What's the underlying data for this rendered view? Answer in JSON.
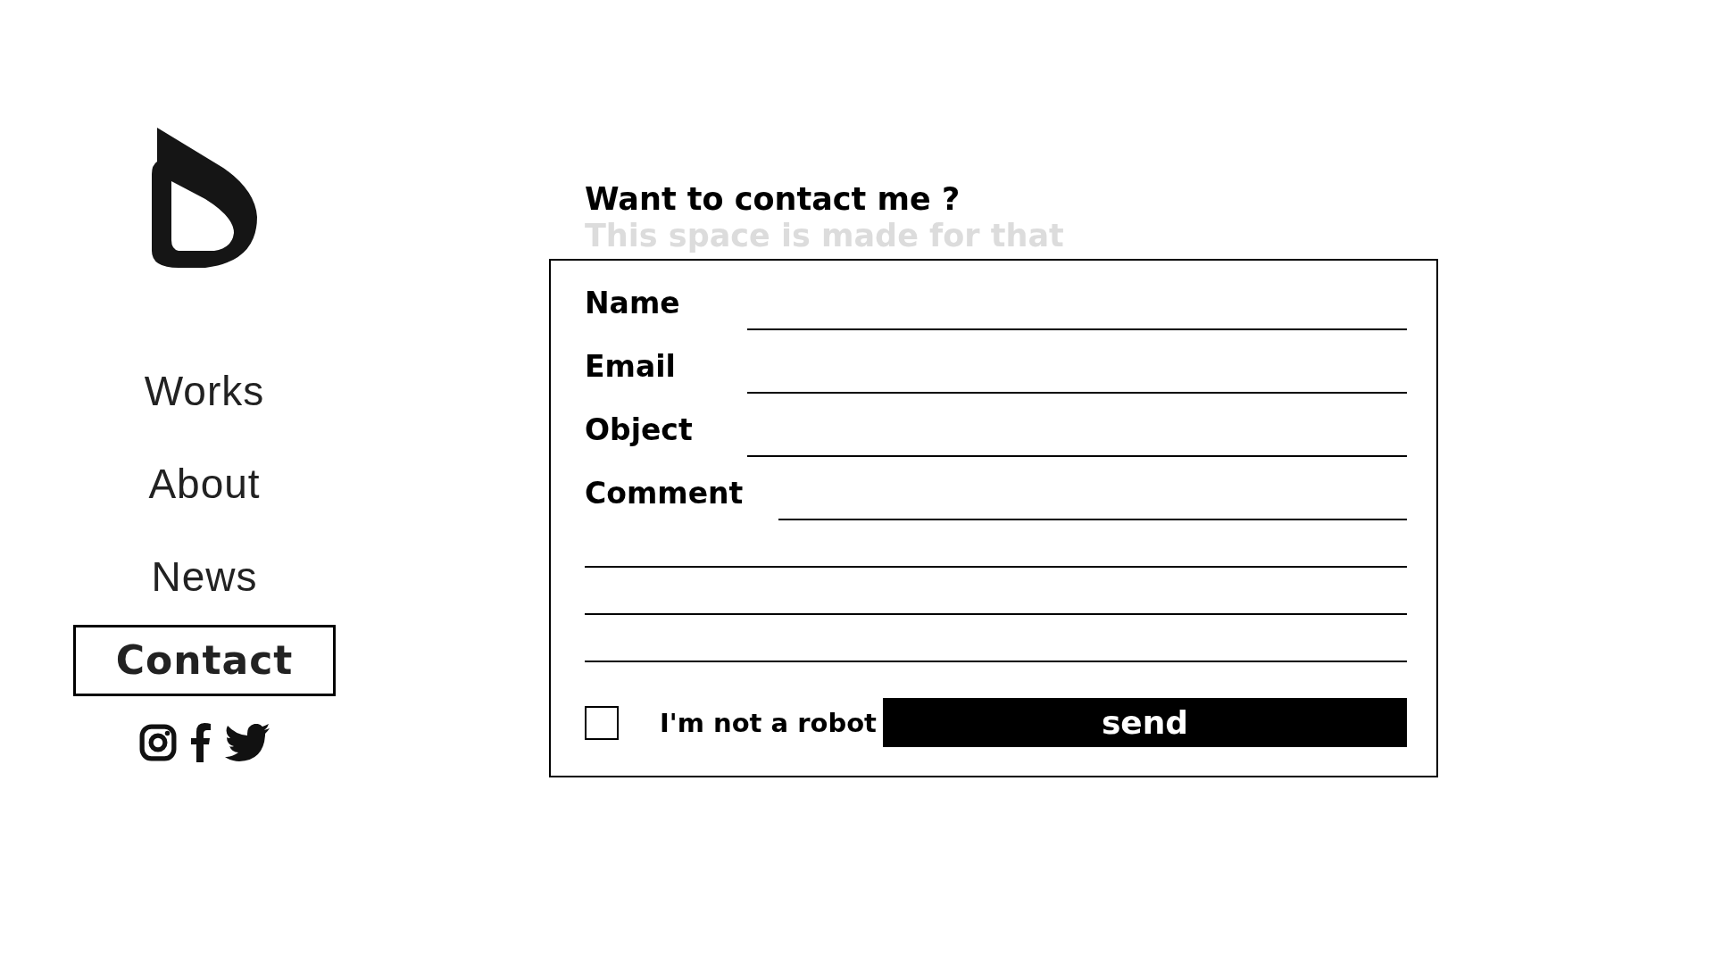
{
  "nav": [
    {
      "label": "Works",
      "selected": false
    },
    {
      "label": "About",
      "selected": false
    },
    {
      "label": "News",
      "selected": false
    },
    {
      "label": "Contact",
      "selected": true
    }
  ],
  "heading": {
    "title": "Want to contact me ?",
    "subtitle": "This space is made for that"
  },
  "form": {
    "fields": [
      {
        "label": "Name"
      },
      {
        "label": "Email"
      },
      {
        "label": "Object"
      },
      {
        "label": "Comment"
      }
    ],
    "captcha": {
      "label": "I'm not a robot",
      "checked": false
    },
    "submit": "send"
  }
}
